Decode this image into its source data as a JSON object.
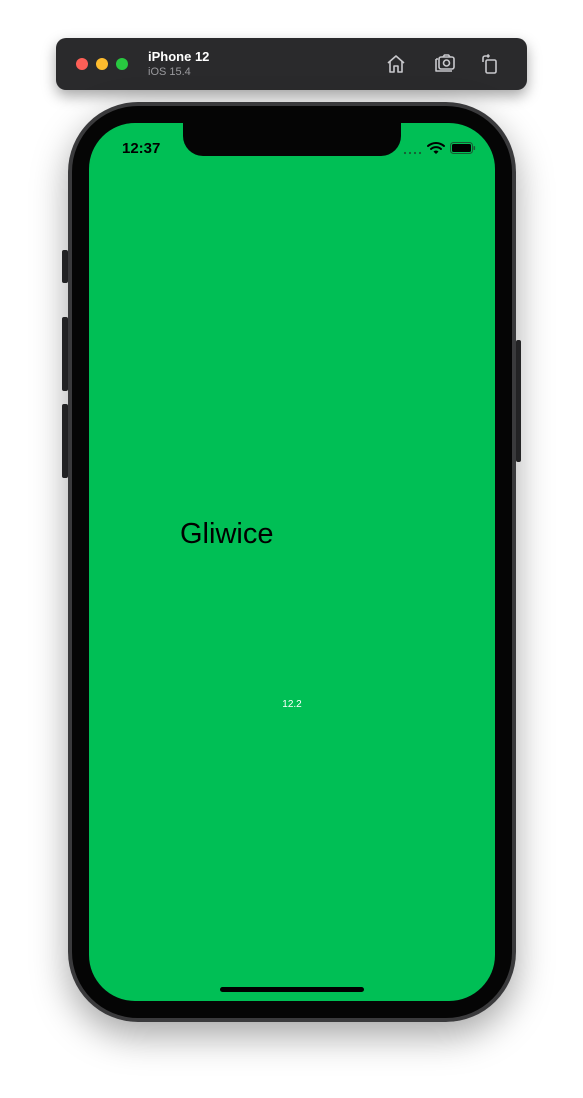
{
  "simulator": {
    "device_name": "iPhone 12",
    "os_version": "iOS 15.4",
    "toolbar_icons": [
      "home-icon",
      "screenshot-icon",
      "rotate-icon"
    ],
    "window_controls": {
      "close_color": "#fe5f57",
      "minimize_color": "#febc2e",
      "zoom_color": "#28c840"
    }
  },
  "status_bar": {
    "time": "12:37",
    "icons": [
      "signal-icon",
      "wifi-icon",
      "battery-icon"
    ]
  },
  "app": {
    "background_color": "#00bf55",
    "city": "Gliwice",
    "value": "12.2"
  }
}
